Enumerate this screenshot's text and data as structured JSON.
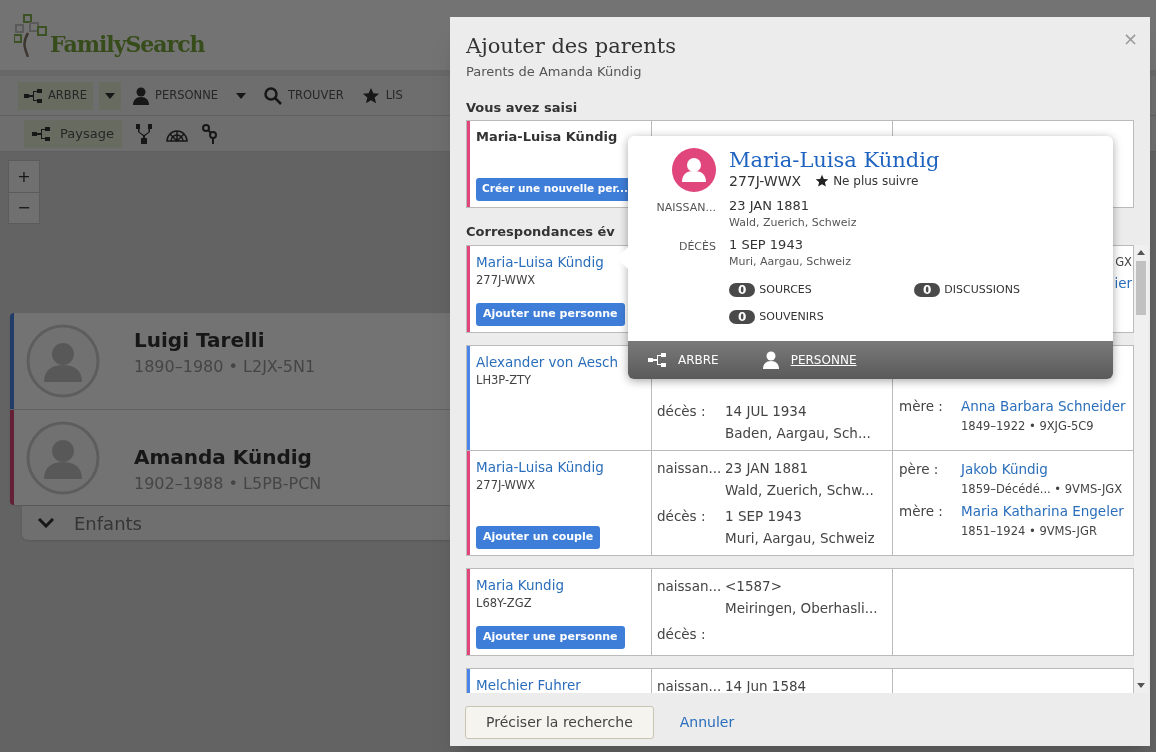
{
  "app": {
    "logo": "FamilySearch"
  },
  "nav": [
    {
      "label": "ARBRE",
      "selected": true,
      "dropdown": true
    },
    {
      "label": "PERSONNE",
      "selected": false,
      "dropdown": true
    },
    {
      "label": "TROUVER",
      "selected": false,
      "dropdown": false
    },
    {
      "label": "LIS",
      "selected": false,
      "dropdown": false
    }
  ],
  "subnav": {
    "label": "Paysage",
    "selected": true
  },
  "zoom": [
    "+",
    "−"
  ],
  "couple": [
    {
      "name": "Luigi Tarelli",
      "details": "1890–1980 • L2JX-5N1",
      "color": "#213c68"
    },
    {
      "name": "Amanda Kündig",
      "details": "1902–1988 • L5PB-PCN",
      "color": "#651f37"
    }
  ],
  "children_toggle": {
    "label": "Enfants",
    "expanded": false
  },
  "dialog": {
    "title": "Ajouter des parents",
    "subtitle": "Parents de Amanda Kündig",
    "close": "×",
    "entered": {
      "heading": "Vous avez saisi",
      "name": "Maria-Luisa Kündig",
      "color": "#e0457b",
      "button": "Créer une nouvelle per..."
    },
    "matches_heading": "Correspondances év",
    "groups": [
      {
        "persons": [
          {
            "name": "Maria-Luisa Kündig",
            "pid": "277J-WWX",
            "color": "#e0457b",
            "button": "Ajouter une personne",
            "fragments": [
              {
                "text": "GX",
                "kind": "detail"
              },
              {
                "text": "ier",
                "kind": "link"
              }
            ]
          }
        ]
      },
      {
        "persons": [
          {
            "name": "Alexander von Aesch",
            "pid": "LH3P-ZTY",
            "color": "#4a86e8",
            "events": [
              {
                "label": "décès :",
                "date": "14 JUL 1934",
                "place": "Baden, Aargau, Sch..."
              }
            ],
            "parents": [
              {
                "role": "mère :",
                "name": "Anna Barbara Schneider",
                "details": "1849–1922 • 9XJG-5C9"
              }
            ]
          },
          {
            "name": "Maria-Luisa Kündig",
            "pid": "277J-WWX",
            "color": "#e0457b",
            "button": "Ajouter un couple",
            "events": [
              {
                "label": "naissan...",
                "date": "23 JAN 1881",
                "place": "Wald, Zuerich, Schw..."
              },
              {
                "label": "décès :",
                "date": "1 SEP 1943",
                "place": "Muri, Aargau, Schweiz"
              }
            ],
            "parents": [
              {
                "role": "père :",
                "name": "Jakob Kündig",
                "details": "1859–Décédé... • 9VMS-JGX"
              },
              {
                "role": "mère :",
                "name": "Maria Katharina Engeler",
                "details": "1851–1924 • 9VMS-JGR"
              }
            ]
          }
        ]
      },
      {
        "persons": [
          {
            "name": "Maria Kundig",
            "pid": "L68Y-ZGZ",
            "color": "#e0457b",
            "button": "Ajouter une personne",
            "events": [
              {
                "label": "naissan...",
                "date": "<1587>",
                "place": "Meiringen, Oberhasli..."
              },
              {
                "label": "décès :"
              }
            ]
          }
        ]
      },
      {
        "persons": [
          {
            "name": "Melchier Fuhrer",
            "color": "#4a86e8",
            "events": [
              {
                "label": "naissan...",
                "date": "14 Jun 1584"
              }
            ]
          }
        ]
      }
    ],
    "buttons": [
      {
        "label": "Préciser la recherche",
        "kind": "secondary"
      },
      {
        "label": "Annuler",
        "kind": "link"
      }
    ]
  },
  "popover": {
    "name": "Maria-Luisa Kündig",
    "pid": "277J-WWX",
    "color": "#e0457b",
    "follow": "Ne plus suivre",
    "events": [
      {
        "label": "NAISSAN...",
        "date": "23 JAN 1881",
        "place": "Wald, Zuerich, Schweiz"
      },
      {
        "label": "DÉCÈS",
        "date": "1 SEP 1943",
        "place": "Muri, Aargau, Schweiz"
      }
    ],
    "counts": [
      {
        "count": "0",
        "label": "SOURCES"
      },
      {
        "count": "0",
        "label": "DISCUSSIONS"
      },
      {
        "count": "0",
        "label": "SOUVENIRS"
      }
    ],
    "actions": [
      {
        "label": "ARBRE",
        "hovered": false
      },
      {
        "label": "PERSONNE",
        "hovered": true
      }
    ]
  }
}
